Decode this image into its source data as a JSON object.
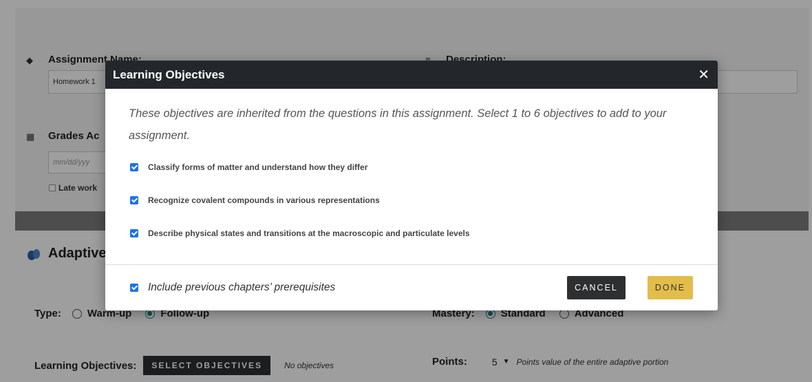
{
  "background": {
    "assignment_name_label": "Assignment Name:",
    "assignment_name_value": "Homework 1",
    "description_label": "Description:",
    "grades_label": "Grades Ac",
    "date_placeholder": "mm/dd/yyy",
    "late_work_label": "Late work",
    "adaptive_title": "Adaptive",
    "type_label": "Type:",
    "type_options": [
      "Warm-up",
      "Follow-up"
    ],
    "mastery_label": "Mastery:",
    "mastery_options": [
      "Standard",
      "Advanced"
    ],
    "learning_objectives_label": "Learning Objectives:",
    "select_objectives_button": "SELECT OBJECTIVES",
    "no_objectives_text": "No objectives",
    "points_label": "Points:",
    "points_value": "5",
    "points_note": "Points value of the entire adaptive portion"
  },
  "modal": {
    "title": "Learning Objectives",
    "close_glyph": "✕",
    "intro": "These objectives are inherited from the questions in this assignment. Select 1 to 6 objectives to add to your assignment.",
    "objectives": [
      {
        "label": "Classify forms of matter and understand how they differ",
        "checked": true
      },
      {
        "label": "Recognize covalent compounds in various representations",
        "checked": true
      },
      {
        "label": "Describe physical states and transitions at the macroscopic and particulate levels",
        "checked": true
      }
    ],
    "include_prereq_label": "Include previous chapters’ prerequisites",
    "cancel_label": "CANCEL",
    "done_label": "DONE"
  },
  "colors": {
    "header_bg": "#23272b",
    "checkbox": "#1a73e8",
    "done_button": "#e2bd4a",
    "cancel_button": "#2d2f31",
    "radio_selected": "#1e7f86"
  }
}
